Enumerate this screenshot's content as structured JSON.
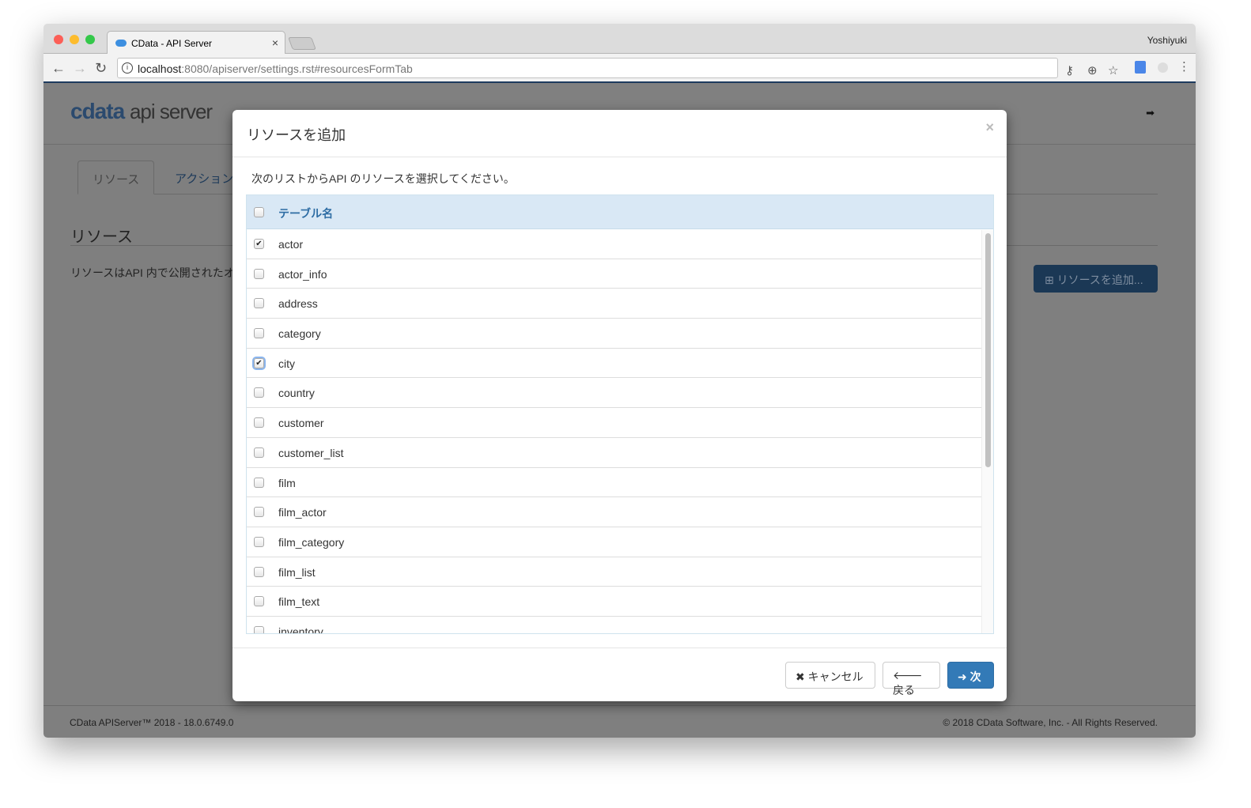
{
  "browser": {
    "tab_title": "CData - API Server",
    "user": "Yoshiyuki",
    "url_host": "localhost",
    "url_rest": ":8080/apiserver/settings.rst#resourcesFormTab"
  },
  "page": {
    "logo_brand": "cdata",
    "logo_product": "api server",
    "tabs": [
      "リソース",
      "アクション"
    ],
    "heading": "リソース",
    "description": "リソースはAPI 内で公開されたオ",
    "add_button": "⊞ リソースを追加...",
    "footer_left": "CData APIServer™ 2018 - 18.0.6749.0",
    "footer_right": "© 2018 CData Software, Inc. - All Rights Reserved."
  },
  "modal": {
    "title": "リソースを追加",
    "close": "×",
    "description": "次のリストからAPI のリソースを選択してください。",
    "column_header": "テーブル名",
    "rows": [
      {
        "name": "actor",
        "checked": true
      },
      {
        "name": "actor_info",
        "checked": false
      },
      {
        "name": "address",
        "checked": false
      },
      {
        "name": "category",
        "checked": false
      },
      {
        "name": "city",
        "checked": true
      },
      {
        "name": "country",
        "checked": false
      },
      {
        "name": "customer",
        "checked": false
      },
      {
        "name": "customer_list",
        "checked": false
      },
      {
        "name": "film",
        "checked": false
      },
      {
        "name": "film_actor",
        "checked": false
      },
      {
        "name": "film_category",
        "checked": false
      },
      {
        "name": "film_list",
        "checked": false
      },
      {
        "name": "film_text",
        "checked": false
      },
      {
        "name": "inventory",
        "checked": false
      }
    ],
    "cancel": "✖ キャンセル",
    "back": "🡐 戻る",
    "next": "➜ 次"
  }
}
